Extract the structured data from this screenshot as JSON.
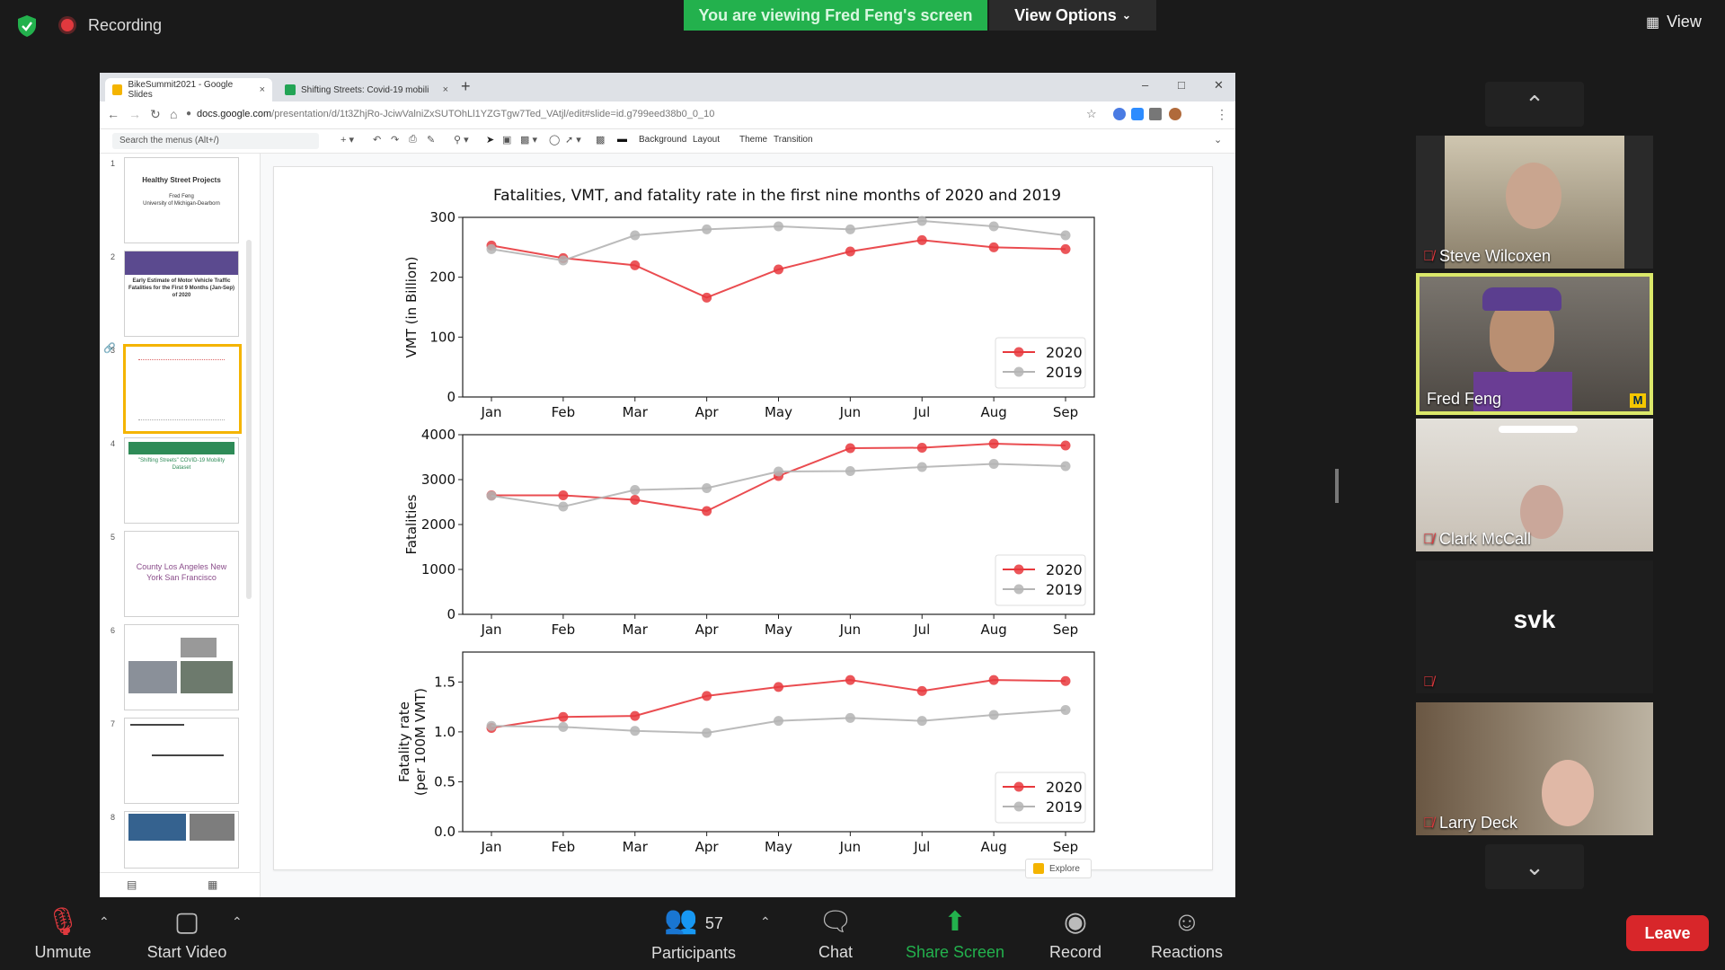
{
  "top": {
    "recording_label": "Recording",
    "viewing_banner": "You are viewing Fred Feng's screen",
    "view_options": "View Options",
    "view_label": "View"
  },
  "browser": {
    "tabs": [
      {
        "title": "BikeSummit2021 - Google Slides",
        "close": "×"
      },
      {
        "title": "Shifting Streets: Covid-19 mobili",
        "close": "×"
      }
    ],
    "new_tab": "+",
    "url_host": "docs.google.com",
    "url_path": "/presentation/d/1t3ZhjRo-JciwValniZxSUTOhLl1YZGTgw7Ted_VAtjl/edit#slide=id.g799eed38b0_0_10"
  },
  "slides_toolbar": {
    "search_menus": "Search the menus (Alt+/)",
    "background": "Background",
    "layout": "Layout",
    "theme": "Theme",
    "transition": "Transition",
    "explore": "Explore"
  },
  "thumbnails": [
    {
      "num": "1",
      "title": "Healthy Street Projects",
      "sub": "Fred Feng\nUniversity of Michigan-Dearborn"
    },
    {
      "num": "2",
      "title": "Early Estimate of Motor Vehicle Traffic Fatalities for the First 9 Months (Jan-Sep) of 2020"
    },
    {
      "num": "3",
      "title": ""
    },
    {
      "num": "4",
      "title": "\"Shifting Streets\" COVID-19 Mobility Dataset"
    },
    {
      "num": "5",
      "title": "County  Los Angeles  New York  San Francisco"
    },
    {
      "num": "6",
      "title": ""
    },
    {
      "num": "7",
      "title": ""
    },
    {
      "num": "8",
      "title": ""
    }
  ],
  "participants": [
    {
      "name": "Steve Wilcoxen",
      "muted": true
    },
    {
      "name": "Fred Feng",
      "muted": false,
      "active": true
    },
    {
      "name": "Clark McCall",
      "muted": true
    },
    {
      "name": "svk",
      "muted": true,
      "avatar_text": "svk"
    },
    {
      "name": "Larry Deck",
      "muted": true
    }
  ],
  "bottom_bar": {
    "unmute": "Unmute",
    "start_video": "Start Video",
    "participants": "Participants",
    "participant_count": "57",
    "chat": "Chat",
    "share_screen": "Share Screen",
    "record": "Record",
    "reactions": "Reactions",
    "leave": "Leave"
  },
  "chart_data": [
    {
      "type": "line",
      "title": "Fatalities, VMT, and fatality rate in the first nine months of 2020 and 2019",
      "ylabel": "VMT (in Billion)",
      "categories": [
        "Jan",
        "Feb",
        "Mar",
        "Apr",
        "May",
        "Jun",
        "Jul",
        "Aug",
        "Sep"
      ],
      "ylim": [
        0,
        300
      ],
      "yticks": [
        "0",
        "100",
        "200",
        "300"
      ],
      "legend": "bottom-right",
      "series": [
        {
          "name": "2020",
          "color": "#e8383d",
          "values": [
            253,
            232,
            220,
            166,
            213,
            243,
            262,
            250,
            247
          ]
        },
        {
          "name": "2019",
          "color": "#b4b4b4",
          "values": [
            247,
            228,
            270,
            280,
            285,
            280,
            294,
            285,
            270
          ]
        }
      ]
    },
    {
      "type": "line",
      "ylabel": "Fatalities",
      "categories": [
        "Jan",
        "Feb",
        "Mar",
        "Apr",
        "May",
        "Jun",
        "Jul",
        "Aug",
        "Sep"
      ],
      "ylim": [
        0,
        4000
      ],
      "yticks": [
        "0",
        "1000",
        "2000",
        "3000",
        "4000"
      ],
      "legend": "bottom-right",
      "series": [
        {
          "name": "2020",
          "color": "#e8383d",
          "values": [
            2650,
            2650,
            2550,
            2300,
            3080,
            3700,
            3710,
            3800,
            3760
          ]
        },
        {
          "name": "2019",
          "color": "#b4b4b4",
          "values": [
            2640,
            2400,
            2770,
            2810,
            3180,
            3190,
            3280,
            3350,
            3300
          ]
        }
      ]
    },
    {
      "type": "line",
      "ylabel": "Fatality rate\n(per 100M VMT)",
      "categories": [
        "Jan",
        "Feb",
        "Mar",
        "Apr",
        "May",
        "Jun",
        "Jul",
        "Aug",
        "Sep"
      ],
      "ylim": [
        0,
        1.8
      ],
      "yticks": [
        "0.0",
        "0.5",
        "1.0",
        "1.5"
      ],
      "legend": "bottom-right",
      "series": [
        {
          "name": "2020",
          "color": "#e8383d",
          "values": [
            1.04,
            1.15,
            1.16,
            1.36,
            1.45,
            1.52,
            1.41,
            1.52,
            1.51
          ]
        },
        {
          "name": "2019",
          "color": "#b4b4b4",
          "values": [
            1.06,
            1.05,
            1.01,
            0.99,
            1.11,
            1.14,
            1.11,
            1.17,
            1.22
          ]
        }
      ]
    }
  ]
}
